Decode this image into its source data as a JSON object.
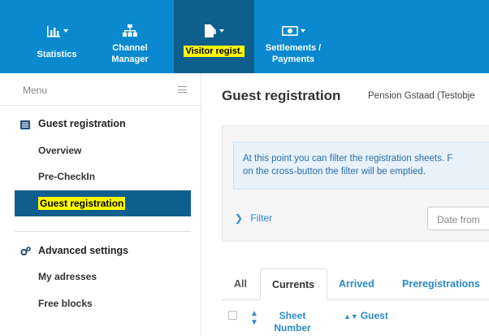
{
  "topnav": {
    "items": [
      {
        "label": "Statistics",
        "icon": "bar-chart-icon"
      },
      {
        "label_line1": "Channel",
        "label_line2": "Manager",
        "icon": "sitemap-icon"
      },
      {
        "label": "Visitor regist.",
        "icon": "document-icon",
        "active": true
      },
      {
        "label_line1": "Settlements /",
        "label_line2": "Payments",
        "icon": "money-icon"
      }
    ]
  },
  "sidebar": {
    "menu_title": "Menu",
    "sections": [
      {
        "title": "Guest registration",
        "icon": "list-icon",
        "items": [
          "Overview",
          "Pre-CheckIn",
          "Guest registration"
        ]
      },
      {
        "title": "Advanced settings",
        "icon": "cogs-icon",
        "items": [
          "My adresses",
          "Free blocks"
        ]
      }
    ]
  },
  "main": {
    "title": "Guest registration",
    "subtitle": "Pension Gstaad (Testobje",
    "info_line1": "At this point you can filter the registration sheets. F",
    "info_line2": "on the cross-button the filter will be emptied.",
    "filter_label": "Filter",
    "date_from_placeholder": "Date from",
    "tabs": [
      "All",
      "Currents",
      "Arrived",
      "Preregistrations"
    ],
    "active_tab": "Currents",
    "columns": {
      "sheet_line1": "Sheet",
      "sheet_line2": "Number",
      "guest": "Guest"
    }
  },
  "colors": {
    "topbar": "#0a89cf",
    "active": "#0e5f8e",
    "highlight": "#fffb00",
    "link": "#2a8bc9"
  }
}
